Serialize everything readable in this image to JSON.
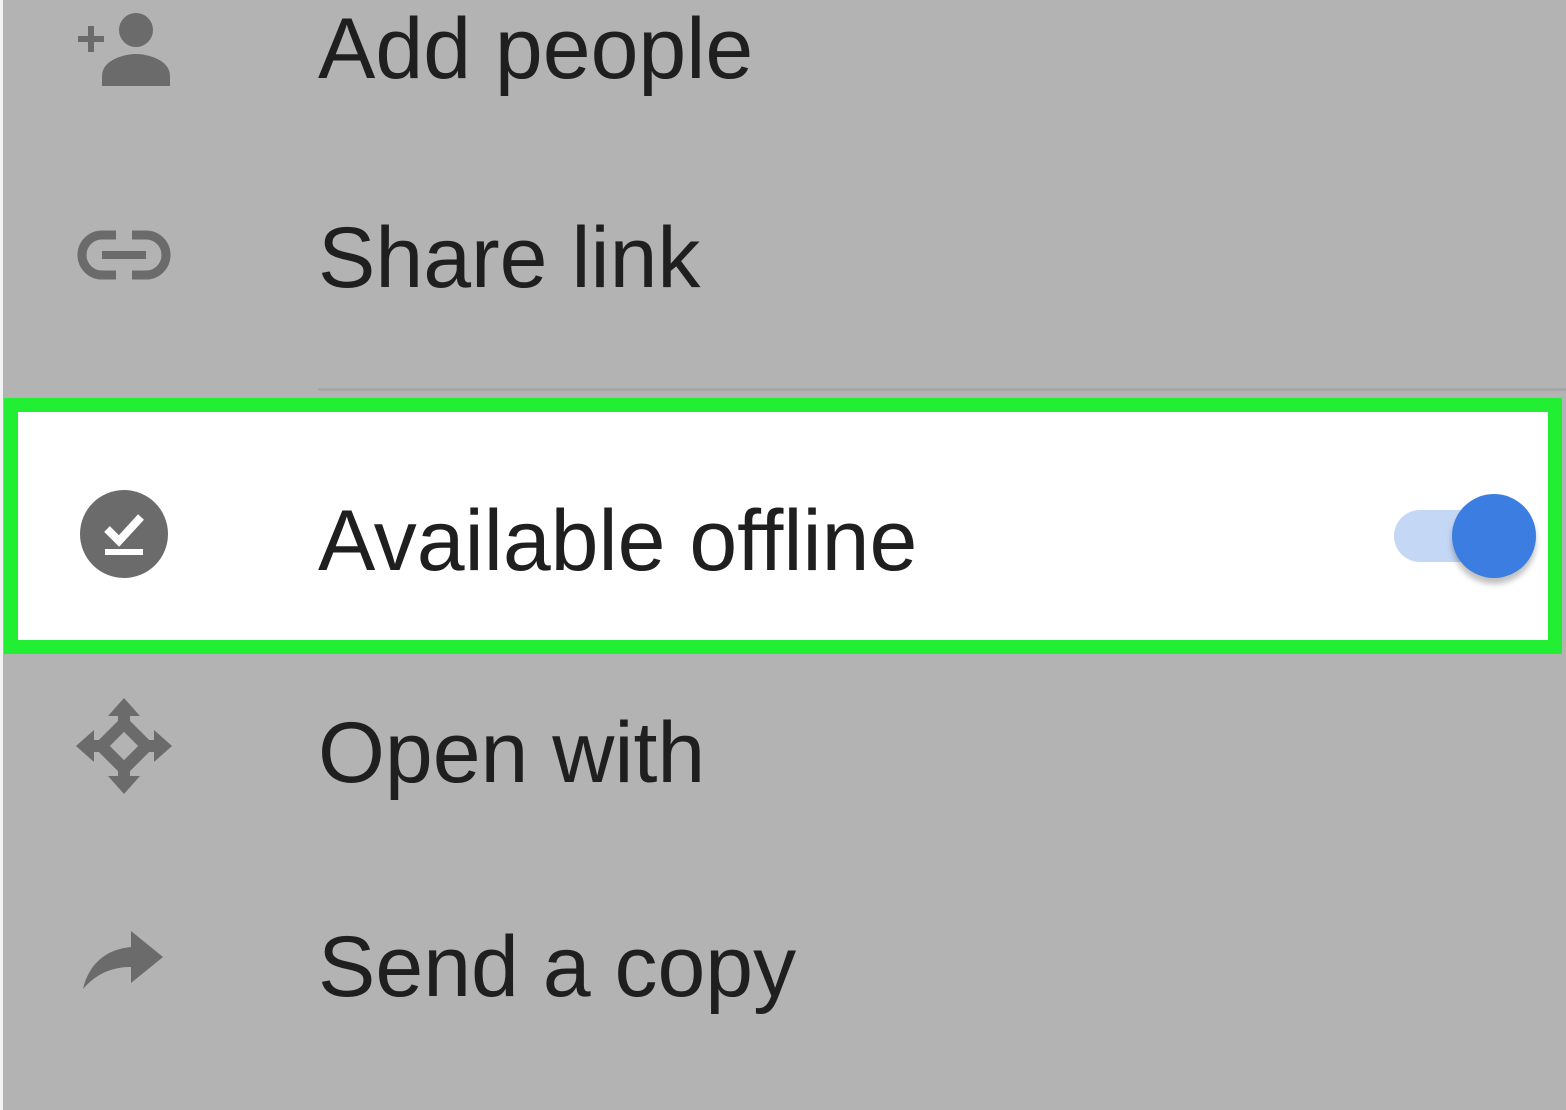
{
  "menu": {
    "items": [
      {
        "label": "Add people",
        "icon": "add-person-icon"
      },
      {
        "label": "Share link",
        "icon": "link-icon"
      },
      {
        "label": "Available offline",
        "icon": "offline-check-icon",
        "toggle_on": true
      },
      {
        "label": "Open with",
        "icon": "open-with-icon"
      },
      {
        "label": "Send a copy",
        "icon": "share-arrow-icon"
      }
    ]
  },
  "colors": {
    "background": "#b3b3b3",
    "highlight_border": "#22ee33",
    "toggle_thumb": "#3b7de0",
    "toggle_track": "#c4d7f5",
    "icon": "#6b6b6b",
    "text": "#1f1f1f"
  }
}
